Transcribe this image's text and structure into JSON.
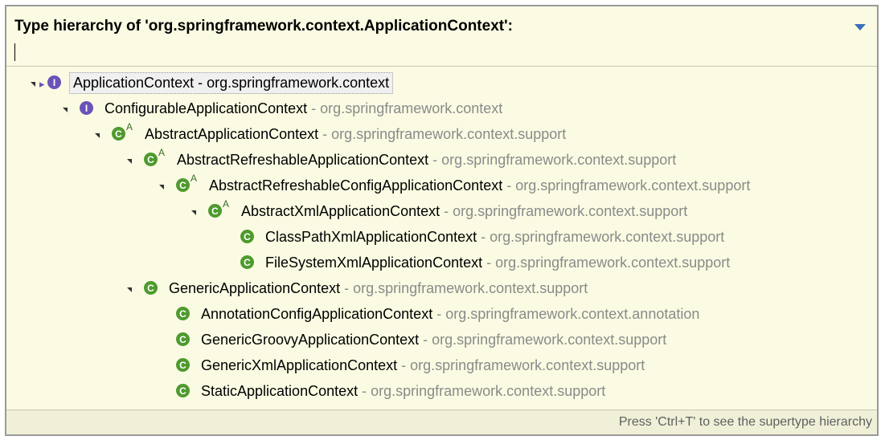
{
  "header": {
    "title": "Type hierarchy of 'org.springframework.context.ApplicationContext':",
    "filter_value": ""
  },
  "tree": [
    {
      "name": "ApplicationContext",
      "sep": " - ",
      "package": "org.springframework.context",
      "kind": "interface-root",
      "abstract": false,
      "expanded": true,
      "selected": true,
      "package_dark": true
    },
    {
      "name": "ConfigurableApplicationContext",
      "sep": " - ",
      "package": "org.springframework.context",
      "kind": "interface",
      "abstract": false,
      "expanded": true
    },
    {
      "name": "AbstractApplicationContext",
      "sep": " - ",
      "package": "org.springframework.context.support",
      "kind": "class",
      "abstract": true,
      "expanded": true
    },
    {
      "name": "AbstractRefreshableApplicationContext",
      "sep": " - ",
      "package": "org.springframework.context.support",
      "kind": "class",
      "abstract": true,
      "expanded": true
    },
    {
      "name": "AbstractRefreshableConfigApplicationContext",
      "sep": " - ",
      "package": "org.springframework.context.support",
      "kind": "class",
      "abstract": true,
      "expanded": true
    },
    {
      "name": "AbstractXmlApplicationContext",
      "sep": " - ",
      "package": "org.springframework.context.support",
      "kind": "class",
      "abstract": true,
      "expanded": true
    },
    {
      "name": "ClassPathXmlApplicationContext",
      "sep": " - ",
      "package": "org.springframework.context.support",
      "kind": "class",
      "abstract": false,
      "expanded": false
    },
    {
      "name": "FileSystemXmlApplicationContext",
      "sep": " - ",
      "package": "org.springframework.context.support",
      "kind": "class",
      "abstract": false,
      "expanded": false
    },
    {
      "name": "GenericApplicationContext",
      "sep": " - ",
      "package": "org.springframework.context.support",
      "kind": "class",
      "abstract": false,
      "expanded": true
    },
    {
      "name": "AnnotationConfigApplicationContext",
      "sep": " - ",
      "package": "org.springframework.context.annotation",
      "kind": "class",
      "abstract": false,
      "expanded": false
    },
    {
      "name": "GenericGroovyApplicationContext",
      "sep": " - ",
      "package": "org.springframework.context.support",
      "kind": "class",
      "abstract": false,
      "expanded": false
    },
    {
      "name": "GenericXmlApplicationContext",
      "sep": " - ",
      "package": "org.springframework.context.support",
      "kind": "class",
      "abstract": false,
      "expanded": false
    },
    {
      "name": "StaticApplicationContext",
      "sep": " - ",
      "package": "org.springframework.context.support",
      "kind": "class",
      "abstract": false,
      "expanded": false
    }
  ],
  "icons": {
    "class_glyph": "C",
    "interface_glyph": "I",
    "abstract_marker": "A"
  },
  "colors": {
    "popup_bg": "#fbfbe3",
    "class_icon": "#4e9a2e",
    "interface_icon": "#6a53b8",
    "package_text": "#8a8a8a"
  },
  "footer": {
    "hint": "Press 'Ctrl+T' to see the supertype hierarchy"
  }
}
